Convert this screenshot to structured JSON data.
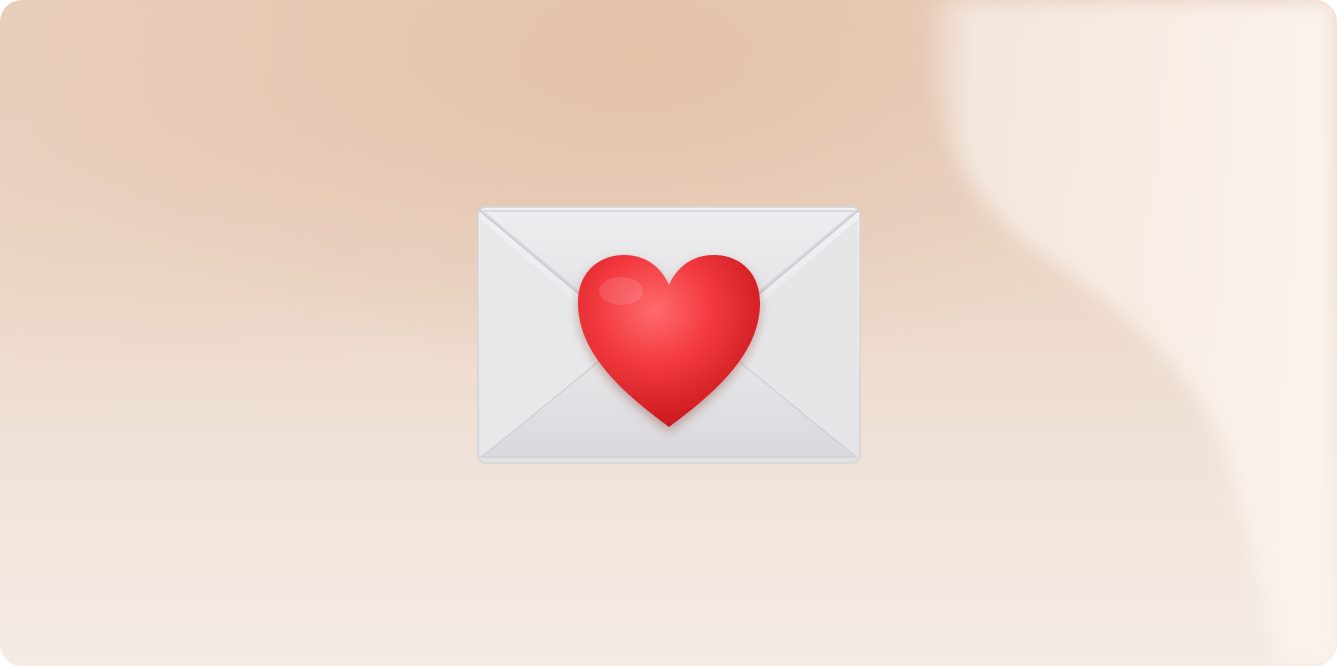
{
  "scene": {
    "icon": "love-letter-icon",
    "colors": {
      "background_peach": "#e3c2aa",
      "background_light": "#f4ebe5",
      "envelope": "#e9e9eb",
      "heart": "#ef2f35"
    }
  }
}
